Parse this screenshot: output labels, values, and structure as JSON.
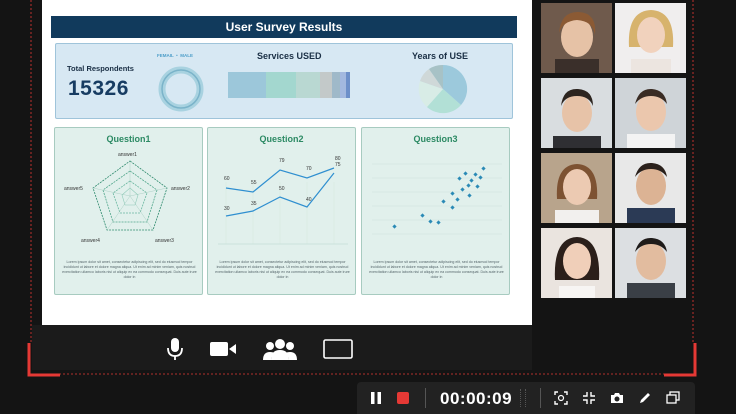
{
  "slide": {
    "title": "User Survey Results",
    "summary": {
      "total_label": "Total Respondents",
      "total_value": "15326",
      "legend_female": "FEMAIL",
      "legend_male": "MALE",
      "services_label": "Services USED",
      "years_label": "Years of USE"
    },
    "questions": [
      {
        "title": "Question1",
        "radar_labels": [
          "answer1",
          "answer2",
          "answer3",
          "answer4",
          "answer5"
        ],
        "text": "Lorem ipsum dolor sit amet, consectetur adipiscing elit, sed do eiusmod tempor incididunt ut labore et dolore magna aliqua. Ut enim ad minim veniam, quis nostrud exercitation ullamco laboris nisi ut aliquip ex ea commodo consequat. Duis aute irure dolor in"
      },
      {
        "title": "Question2",
        "line_labels_top": [
          "60",
          "55",
          "79",
          "70",
          "80",
          "75"
        ],
        "line_labels_bottom": [
          "30",
          "35",
          "50",
          "40"
        ],
        "text": "Lorem ipsum dolor sit amet, consectetur adipiscing elit, sed do eiusmod tempor incididunt ut labore et dolore magna aliqua. Ut enim ad minim veniam, quis nostrud exercitation ullamco laboris nisi ut aliquip ex ea commodo consequat. Duis aute irure dolor in"
      },
      {
        "title": "Question3",
        "text": "Lorem ipsum dolor sit amet, consectetur adipiscing elit, sed do eiusmod tempor incididunt ut labore et dolore magna aliqua. Ut enim ad minim veniam, quis nostrud exercitation ullamco laboris nisi ut aliquip ex ea commodo consequat. Duis aute irure dolor in"
      }
    ]
  },
  "participants": [
    {
      "name": "participant-1"
    },
    {
      "name": "participant-2"
    },
    {
      "name": "participant-3"
    },
    {
      "name": "participant-4"
    },
    {
      "name": "participant-5"
    },
    {
      "name": "participant-6"
    },
    {
      "name": "participant-7"
    },
    {
      "name": "participant-8"
    }
  ],
  "call_controls": [
    "microphone-icon",
    "camera-icon",
    "participants-icon",
    "share-screen-icon"
  ],
  "recorder": {
    "timer": "00:00:09",
    "buttons": [
      "pause-icon",
      "stop-icon",
      "region-icon",
      "collapse-icon",
      "screenshot-icon",
      "annotate-icon",
      "window-icon"
    ]
  },
  "colors": {
    "slide_title_bg": "#113a5c",
    "accent_teal": "#2c8a64",
    "record_red": "#e53935",
    "record_frame": "#e53935"
  }
}
